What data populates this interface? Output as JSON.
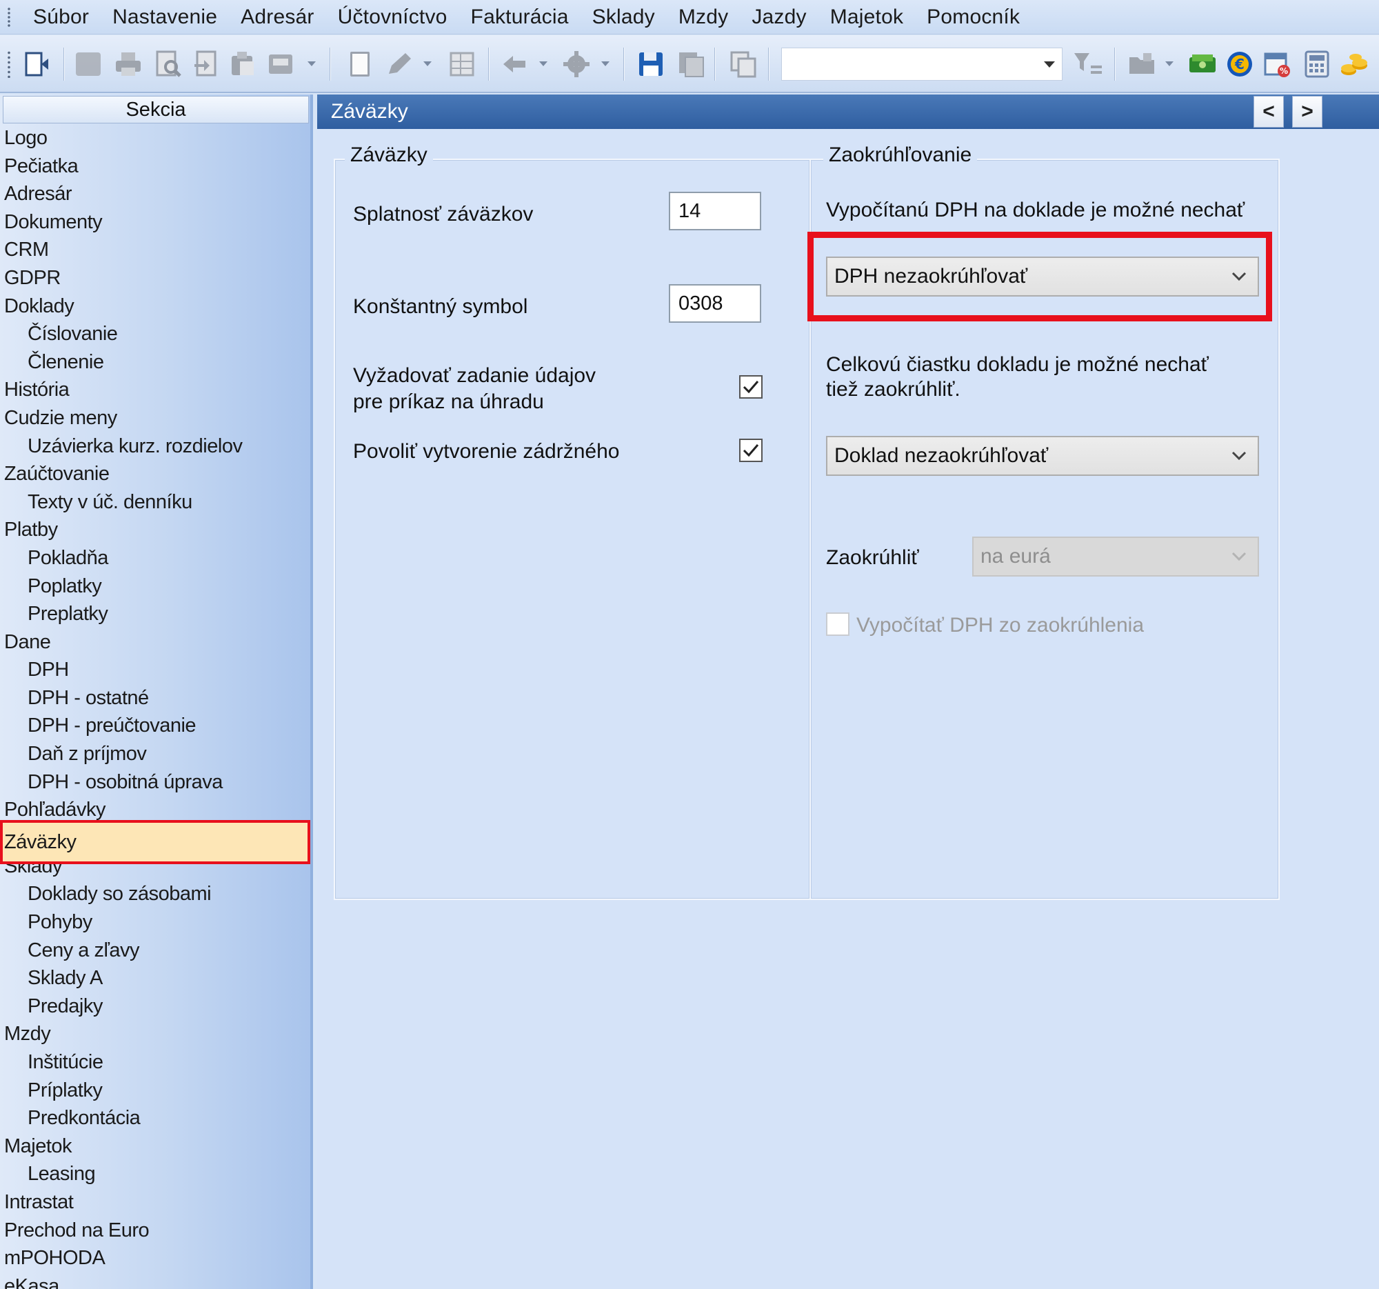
{
  "menu": [
    "Súbor",
    "Nastavenie",
    "Adresár",
    "Účtovníctvo",
    "Fakturácia",
    "Sklady",
    "Mzdy",
    "Jazdy",
    "Majetok",
    "Pomocník"
  ],
  "toolbar": {
    "search_value": "",
    "icons": [
      "agenda-icon",
      "copy-icon",
      "print-icon",
      "preview-icon",
      "export-pdf-icon",
      "paste-icon",
      "send-icon",
      "new-document-icon",
      "edit-icon",
      "table-icon",
      "back-icon",
      "settings-icon",
      "save-icon",
      "save-copy-icon",
      "duplicate-icon",
      "filter-icon",
      "folder-icon",
      "cash-icon",
      "euro-icon",
      "calendar-percent-icon",
      "calculator-icon",
      "coins-icon"
    ]
  },
  "sidebar": {
    "header": "Sekcia",
    "items": [
      {
        "label": "Logo",
        "level": 0
      },
      {
        "label": "Pečiatka",
        "level": 0
      },
      {
        "label": "Adresár",
        "level": 0
      },
      {
        "label": "Dokumenty",
        "level": 0
      },
      {
        "label": "CRM",
        "level": 0
      },
      {
        "label": "GDPR",
        "level": 0
      },
      {
        "label": "Doklady",
        "level": 0
      },
      {
        "label": "Číslovanie",
        "level": 1
      },
      {
        "label": "Členenie",
        "level": 1
      },
      {
        "label": "História",
        "level": 0
      },
      {
        "label": "Cudzie meny",
        "level": 0
      },
      {
        "label": "Uzávierka kurz. rozdielov",
        "level": 1
      },
      {
        "label": "Zaúčtovanie",
        "level": 0
      },
      {
        "label": "Texty v úč. denníku",
        "level": 1
      },
      {
        "label": "Platby",
        "level": 0
      },
      {
        "label": "Pokladňa",
        "level": 1
      },
      {
        "label": "Poplatky",
        "level": 1
      },
      {
        "label": "Preplatky",
        "level": 1
      },
      {
        "label": "Dane",
        "level": 0
      },
      {
        "label": "DPH",
        "level": 1
      },
      {
        "label": "DPH - ostatné",
        "level": 1
      },
      {
        "label": "DPH - preúčtovanie",
        "level": 1
      },
      {
        "label": "Daň z príjmov",
        "level": 1
      },
      {
        "label": "DPH - osobitná úprava",
        "level": 1
      },
      {
        "label": "Pohľadávky",
        "level": 0
      },
      {
        "label": "Záväzky",
        "level": 0,
        "selected": true
      },
      {
        "label": "Sklady",
        "level": 0
      },
      {
        "label": "Doklady so zásobami",
        "level": 1
      },
      {
        "label": "Pohyby",
        "level": 1
      },
      {
        "label": "Ceny a zľavy",
        "level": 1
      },
      {
        "label": "Sklady A",
        "level": 1
      },
      {
        "label": "Predajky",
        "level": 1
      },
      {
        "label": "Mzdy",
        "level": 0
      },
      {
        "label": "Inštitúcie",
        "level": 1
      },
      {
        "label": "Príplatky",
        "level": 1
      },
      {
        "label": "Predkontácia",
        "level": 1
      },
      {
        "label": "Majetok",
        "level": 0
      },
      {
        "label": "Leasing",
        "level": 1
      },
      {
        "label": "Intrastat",
        "level": 0
      },
      {
        "label": "Prechod na Euro",
        "level": 0
      },
      {
        "label": "mPOHODA",
        "level": 0
      },
      {
        "label": "eKasa",
        "level": 0
      }
    ]
  },
  "main": {
    "title": "Záväzky",
    "nav_prev": "<",
    "nav_next": ">",
    "left_group": {
      "title": "Záväzky",
      "splatnost_label": "Splatnosť záväzkov",
      "splatnost_value": "14",
      "ks_label": "Konštantný symbol",
      "ks_value": "0308",
      "vyzadovat_label_1": "Vyžadovať zadanie údajov",
      "vyzadovat_label_2": "pre príkaz na úhradu",
      "vyzadovat_checked": true,
      "povolit_label": "Povoliť vytvorenie zádržného",
      "povolit_checked": true
    },
    "right_group": {
      "title": "Zaokrúhľovanie",
      "dph_hint": "Vypočítanú DPH na doklade je možné nechať",
      "dph_combo": "DPH nezaokrúhľovať",
      "total_hint_1": "Celkovú čiastku dokladu je možné nechať",
      "total_hint_2": "tiež zaokrúhliť.",
      "doklad_combo": "Doklad nezaokrúhľovať",
      "zaokruhlit_label": "Zaokrúhliť",
      "zaokruhlit_combo": "na eurá",
      "vypocitat_label": "Vypočítať DPH zo zaokrúhlenia",
      "vypocitat_checked": false
    }
  },
  "colors": {
    "highlight": "#e8101c",
    "title_bar": "#3565a7",
    "selection": "#fde6b6"
  }
}
